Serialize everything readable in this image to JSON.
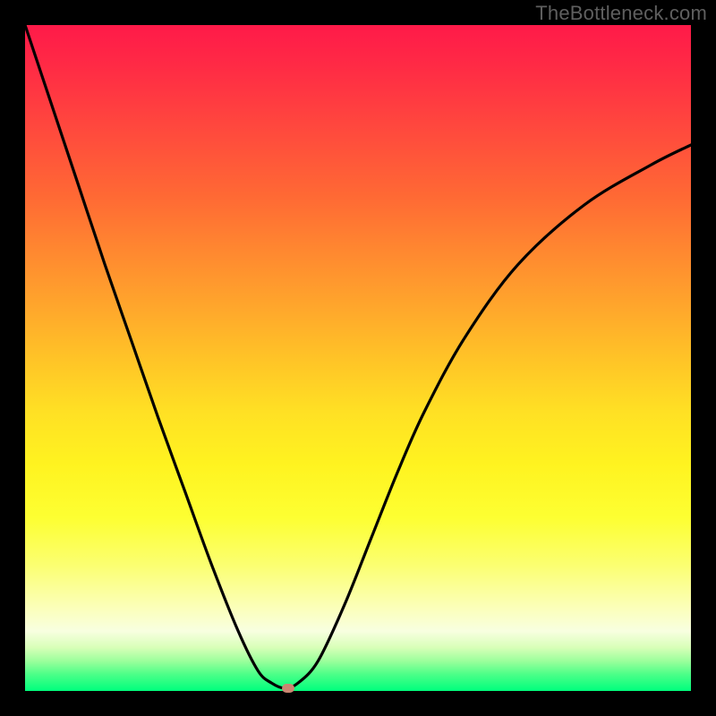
{
  "attribution": "TheBottleneck.com",
  "colors": {
    "page_bg": "#000000",
    "curve": "#000000",
    "marker": "#cb8671",
    "attribution_text": "#5f5f5f",
    "gradient_top": "#ff1a49",
    "gradient_bottom": "#00ff7d"
  },
  "chart_data": {
    "type": "line",
    "title": "",
    "xlabel": "",
    "ylabel": "",
    "xlim": [
      0,
      100
    ],
    "ylim": [
      0,
      100
    ],
    "grid": false,
    "legend": false,
    "series": [
      {
        "name": "bottleneck-curve",
        "x": [
          0,
          4,
          8,
          12,
          16,
          20,
          24,
          28,
          32,
          35,
          37,
          39,
          41,
          44,
          48,
          52,
          56,
          60,
          66,
          74,
          84,
          94,
          100
        ],
        "y": [
          100,
          88,
          76,
          64,
          52.5,
          41,
          30,
          19,
          9,
          3,
          1.2,
          0.4,
          1.2,
          4.5,
          13,
          23,
          33,
          42,
          53,
          64,
          73,
          79,
          82
        ]
      }
    ],
    "marker": {
      "x": 39.5,
      "y": 0.4
    },
    "annotations": []
  }
}
